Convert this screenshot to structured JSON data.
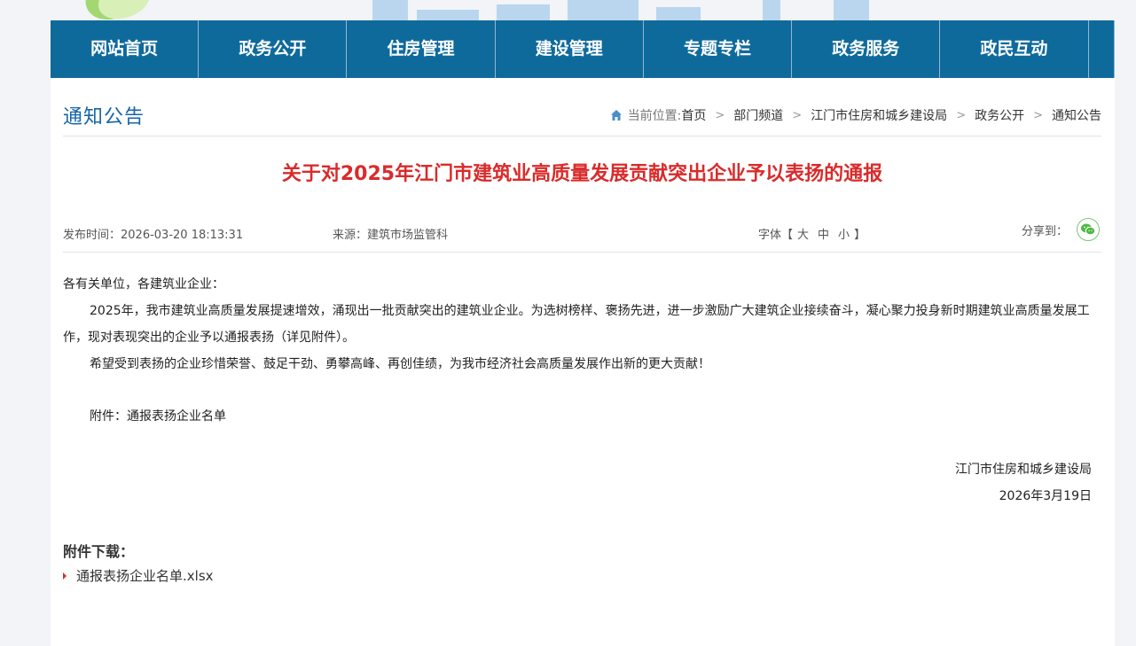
{
  "nav": {
    "items": [
      "网站首页",
      "政务公开",
      "住房管理",
      "建设管理",
      "专题专栏",
      "政务服务",
      "政民互动"
    ]
  },
  "section_title": "通知公告",
  "breadcrumb": {
    "label": "当前位置:",
    "items": [
      "首页",
      "部门频道",
      "江门市住房和城乡建设局",
      "政务公开",
      "通知公告"
    ],
    "separator": ">"
  },
  "article": {
    "title": "关于对2025年江门市建筑业高质量发展贡献突出企业予以表扬的通报",
    "publish_label": "发布时间：",
    "publish_time": "2026-03-20 18:13:31",
    "source_label": "来源：",
    "source": "建筑市场监管科",
    "font_label": "字体【",
    "font_sizes": [
      "大",
      "中",
      "小"
    ],
    "font_end": "】",
    "share_label": "分享到：",
    "salutation": "各有关单位，各建筑业企业：",
    "paragraph1": "2025年，我市建筑业高质量发展提速增效，涌现出一批贡献突出的建筑业企业。为选树榜样、褒扬先进，进一步激励广大建筑企业接续奋斗，凝心聚力投身新时期建筑业高质量发展工作，现对表现突出的企业予以通报表扬（详见附件）。",
    "paragraph2": "希望受到表扬的企业珍惜荣誉、鼓足干劲、勇攀高峰、再创佳绩，为我市经济社会高质量发展作出新的更大贡献！",
    "attachment_note": "附件：通报表扬企业名单",
    "signature": "江门市住房和城乡建设局",
    "date": "2026年3月19日"
  },
  "attachments": {
    "title": "附件下载：",
    "files": [
      "通报表扬企业名单.xlsx"
    ]
  },
  "colors": {
    "nav_bg": "#0f6a9c",
    "title_red": "#d92b2b",
    "section_blue": "#1565a8",
    "wechat_green": "#4cb944"
  },
  "icons": [
    "home-icon",
    "wechat-icon",
    "triangle-bullet-icon"
  ]
}
